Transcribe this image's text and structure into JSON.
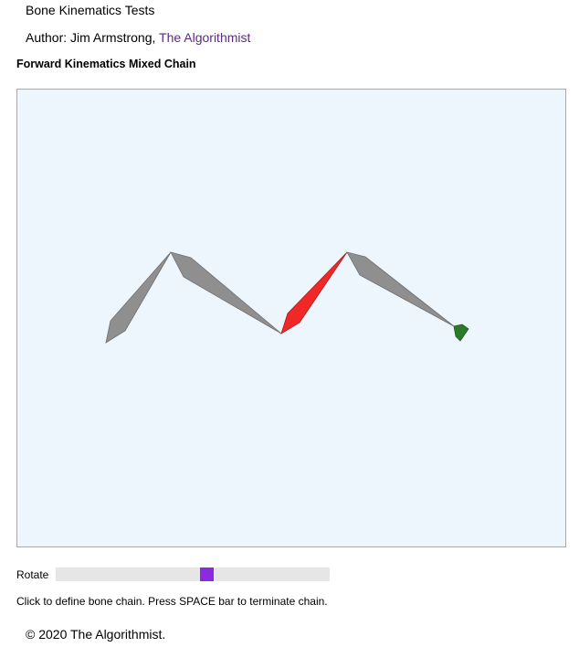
{
  "page": {
    "title": "Bone Kinematics Tests",
    "author_prefix": "Author: Jim Armstrong, ",
    "author_link": "The Algorithmist",
    "heading": "Forward Kinematics Mixed Chain"
  },
  "canvas": {
    "background": "#edf5fd",
    "border": "#a8a8a8",
    "bones": [
      {
        "role": "fk-bone",
        "color": "#8f8f8f"
      },
      {
        "role": "fk-bone",
        "color": "#8f8f8f"
      },
      {
        "role": "selected-bone",
        "color": "#f02828"
      },
      {
        "role": "fk-bone",
        "color": "#8f8f8f"
      },
      {
        "role": "end-effector",
        "color": "#2a7a2a"
      }
    ]
  },
  "controls": {
    "rotate_label": "Rotate",
    "rotate_value": 0.555,
    "slider_track_color": "#e6e6e6",
    "slider_thumb_color": "#8a2be2"
  },
  "instructions": "Click to define bone chain. Press SPACE bar to terminate chain.",
  "footer": "© 2020 The Algorithmist."
}
